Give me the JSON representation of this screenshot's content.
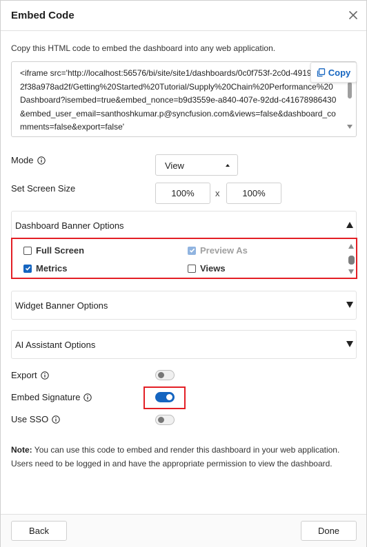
{
  "dialog": {
    "title": "Embed Code",
    "description": "Copy this HTML code to embed the dashboard into any web application.",
    "code": "<iframe src='http://localhost:56576/bi/site/site1/dashboards/0c0f753f-2c0d-4919-8bca-2f38a978ad2f/Getting%20Started%20Tutorial/Supply%20Chain%20Performance%20Dashboard?isembed=true&embed_nonce=b9d3559e-a840-407e-92dd-c41678986430&embed_user_email=santhoshkumar.p@syncfusion.com&views=false&dashboard_comments=false&export=false'",
    "copy_label": "Copy"
  },
  "mode": {
    "label": "Mode",
    "value": "View"
  },
  "screen_size": {
    "label": "Set Screen Size",
    "width": "100%",
    "separator": "x",
    "height": "100%"
  },
  "dashboard_banner": {
    "title": "Dashboard Banner Options",
    "options": [
      {
        "label": "Full Screen",
        "checked": false,
        "disabled": false
      },
      {
        "label": "Preview As",
        "checked": true,
        "disabled": true
      },
      {
        "label": "Metrics",
        "checked": true,
        "disabled": false
      },
      {
        "label": "Views",
        "checked": false,
        "disabled": false
      }
    ]
  },
  "widget_banner": {
    "title": "Widget Banner Options"
  },
  "ai_assistant": {
    "title": "AI Assistant Options"
  },
  "toggles": [
    {
      "label": "Export",
      "on": false
    },
    {
      "label": "Embed Signature",
      "on": true
    },
    {
      "label": "Use SSO",
      "on": false
    }
  ],
  "note": {
    "prefix": "Note:",
    "text": " You can use this code to embed and render this dashboard in your web application. Users need to be logged in and have the appropriate permission to view the dashboard."
  },
  "footer": {
    "back_label": "Back",
    "done_label": "Done"
  },
  "colors": {
    "accent": "#1565c0",
    "highlight": "#e31e24"
  }
}
